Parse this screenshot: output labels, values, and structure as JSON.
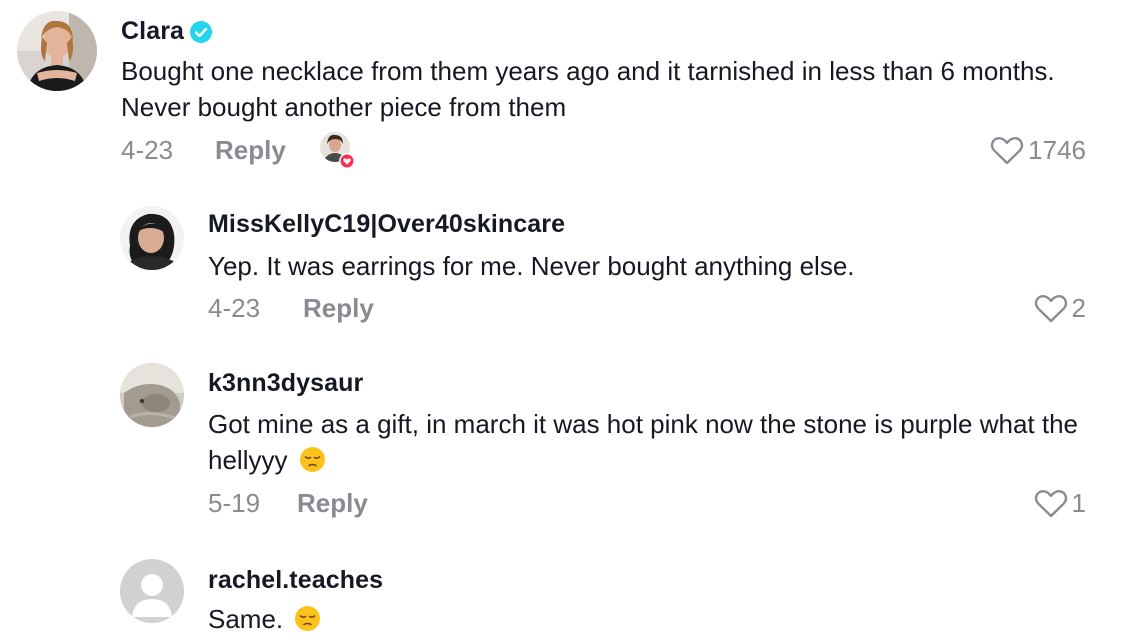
{
  "comments": [
    {
      "username": "Clara",
      "verified": true,
      "text": "Bought one necklace from them years ago and it tarnished in less than 6 months. Never bought another piece from them",
      "date": "4-23",
      "reply_label": "Reply",
      "likes": "1746",
      "liked_by_creator": true
    },
    {
      "username": "MissKellyC19|Over40skincare",
      "text": "Yep. It was earrings for me. Never bought anything else.",
      "date": "4-23",
      "reply_label": "Reply",
      "likes": "2"
    },
    {
      "username": "k3nn3dysaur",
      "text": "Got mine as a gift, in march it was hot pink now the stone is purple what the hellyyy",
      "emoji": "pensive-face",
      "date": "5-19",
      "reply_label": "Reply",
      "likes": "1"
    },
    {
      "username": "rachel.teaches",
      "text": "Same.",
      "emoji": "pensive-face"
    }
  ],
  "colors": {
    "text_primary": "#161823",
    "text_secondary": "#8a8b91",
    "verified_blue": "#20d5ec",
    "heart_badge": "#fe2c55"
  }
}
